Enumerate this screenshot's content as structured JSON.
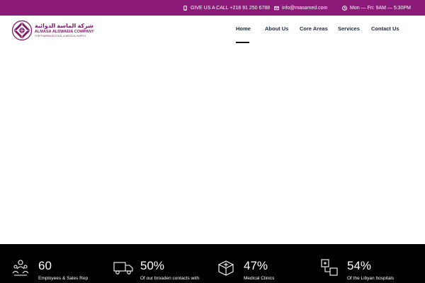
{
  "topbar": {
    "call_text": "GIVE US A CALL +218 91 250 6788",
    "email_text": "info@masamed.com",
    "hours_text": "Mon — Fri: 9AM — 5:30PM"
  },
  "logo": {
    "arabic": "شركة الماسة الدوائية",
    "english": "ALMASA ALDWAEIA COMPANY",
    "subtitle": "FOR PHARMACEUTICAL & MEDICAL SUPPLY"
  },
  "nav": {
    "home": "Home",
    "about": "About Us",
    "core": "Core Areas",
    "services": "Services",
    "contact": "Contact Us",
    "active": "Home"
  },
  "stats": [
    {
      "icon": "employees-icon",
      "value": "60",
      "label": "Employees & Sales Rep"
    },
    {
      "icon": "delivery-truck-icon",
      "value": "50%",
      "label": "Of our broaden contacts with"
    },
    {
      "icon": "medical-box-icon",
      "value": "47%",
      "label": "Medical Clinics"
    },
    {
      "icon": "hospital-network-icon",
      "value": "54%",
      "label": "Of the Libyan hospitals"
    }
  ],
  "colors": {
    "topbar_bg": "#8b1a78",
    "brand": "#7d1569",
    "nav_text": "#1c2a3a",
    "stats_bg": "#000000"
  }
}
